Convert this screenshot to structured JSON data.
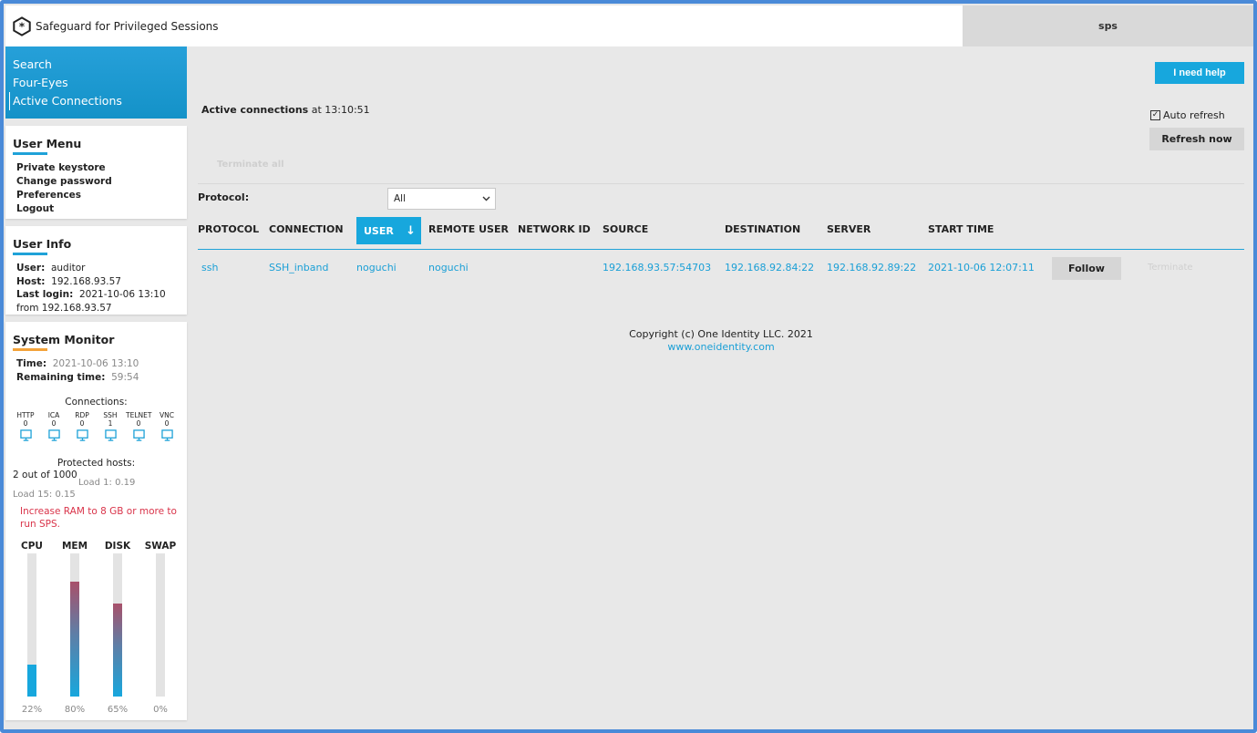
{
  "app": {
    "title": "Safeguard for Privileged Sessions",
    "host": "sps"
  },
  "nav": {
    "items": [
      "Search",
      "Four-Eyes",
      "Active Connections"
    ]
  },
  "user_menu": {
    "title": "User Menu",
    "items": [
      "Private keystore",
      "Change password",
      "Preferences",
      "Logout"
    ]
  },
  "user_info": {
    "title": "User Info",
    "user_label": "User:",
    "user": "auditor",
    "host_label": "Host:",
    "host": "192.168.93.57",
    "last_login_label": "Last login:",
    "last_login": "2021-10-06 13:10",
    "from_line": "from 192.168.93.57"
  },
  "system_monitor": {
    "title": "System Monitor",
    "time_label": "Time:",
    "time": "2021-10-06 13:10",
    "remaining_label": "Remaining time:",
    "remaining": "59:54",
    "connections_title": "Connections:",
    "connections": [
      {
        "proto": "HTTP",
        "count": "0"
      },
      {
        "proto": "ICA",
        "count": "0"
      },
      {
        "proto": "RDP",
        "count": "0"
      },
      {
        "proto": "SSH",
        "count": "1"
      },
      {
        "proto": "TELNET",
        "count": "0"
      },
      {
        "proto": "VNC",
        "count": "0"
      }
    ],
    "protected_title": "Protected hosts:",
    "protected_value": "2 out of 1000",
    "load1": "Load 1:  0.19",
    "load15": "Load 15:  0.15",
    "warning": "Increase RAM to 8 GB or more to run SPS.",
    "resources": [
      {
        "name": "CPU",
        "percent": 22,
        "label": "22%"
      },
      {
        "name": "MEM",
        "percent": 80,
        "label": "80%"
      },
      {
        "name": "DISK",
        "percent": 65,
        "label": "65%"
      },
      {
        "name": "SWAP",
        "percent": 0,
        "label": "0%"
      }
    ]
  },
  "main": {
    "help_label": "I need help",
    "heading_bold": "Active connections",
    "heading_rest": "at 13:10:51",
    "auto_refresh_label": "Auto refresh",
    "auto_refresh_checked": true,
    "refresh_label": "Refresh now",
    "terminate_all_label": "Terminate all",
    "protocol_label": "Protocol:",
    "protocol_value": "All",
    "columns": [
      "PROTOCOL",
      "CONNECTION",
      "USER",
      "REMOTE USER",
      "NETWORK ID",
      "SOURCE",
      "DESTINATION",
      "SERVER",
      "START TIME"
    ],
    "sorted_column": "USER",
    "sort_arrow": "↓",
    "rows": [
      {
        "protocol": "ssh",
        "connection": "SSH_inband",
        "user": "noguchi",
        "remote_user": "noguchi",
        "network_id": "",
        "source": "192.168.93.57:54703",
        "destination": "192.168.92.84:22",
        "server": "192.168.92.89:22",
        "start_time": "2021-10-06 12:07:11",
        "follow_label": "Follow",
        "terminate_label": "Terminate"
      }
    ]
  },
  "footer": {
    "copyright": "Copyright (c) One Identity LLC. 2021",
    "link": "www.oneidentity.com"
  },
  "colors": {
    "accent": "#17a7dd",
    "warning": "#d9344a",
    "underline_orange": "#f3a33a",
    "link": "#1a9fd6"
  }
}
